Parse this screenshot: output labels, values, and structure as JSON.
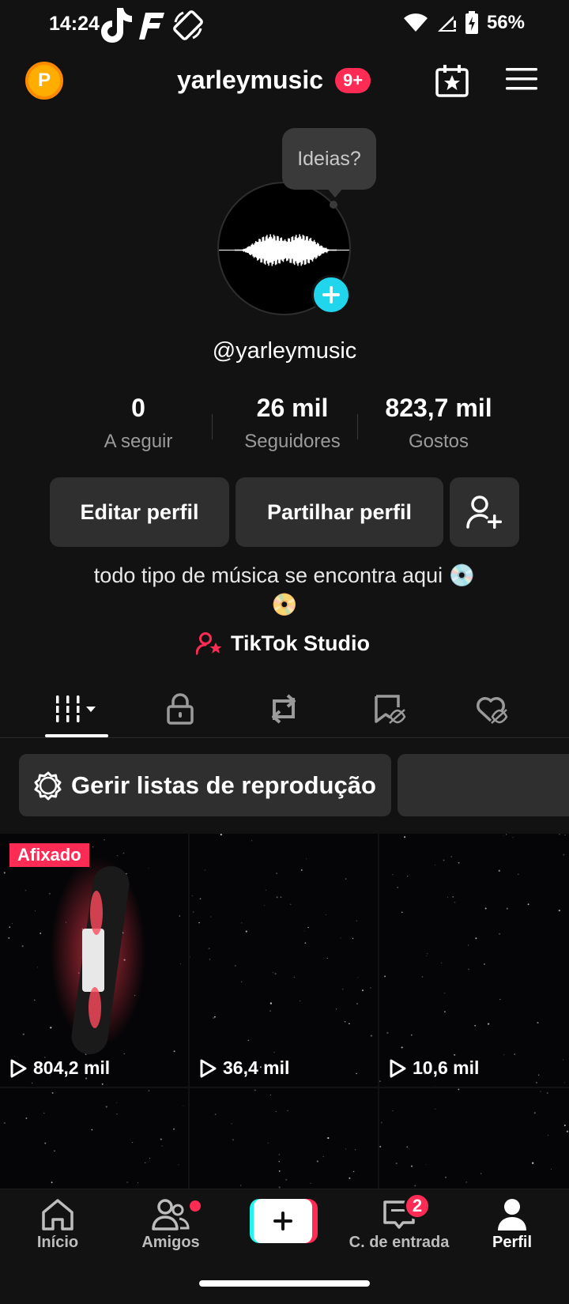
{
  "status": {
    "time": "14:24",
    "battery": "56%"
  },
  "header": {
    "username": "yarleymusic",
    "notifications": "9+",
    "coin_letter": "P"
  },
  "profile": {
    "tooltip": "Ideias?",
    "handle": "@yarleymusic",
    "stats": [
      {
        "value": "0",
        "label": "A seguir"
      },
      {
        "value": "26 mil",
        "label": "Seguidores"
      },
      {
        "value": "823,7 mil",
        "label": "Gostos"
      }
    ],
    "edit_label": "Editar perfil",
    "share_label": "Partilhar perfil",
    "bio_line1": "todo tipo de música se encontra aqui 💿",
    "bio_line2": "📀",
    "studio_label": "TikTok Studio"
  },
  "playlists": {
    "manage_label": "Gerir listas de reprodução"
  },
  "videos": [
    {
      "views": "804,2 mil",
      "pinned": "Afixado"
    },
    {
      "views": "36,4 mil"
    },
    {
      "views": "10,6 mil"
    }
  ],
  "nav": {
    "home": "Início",
    "friends": "Amigos",
    "inbox": "C. de entrada",
    "inbox_count": "2",
    "profile": "Perfil"
  },
  "colors": {
    "accent": "#fe2c55",
    "cyan": "#25f4ee",
    "avatar_add": "#20d5ec",
    "coin": "#ffae00"
  }
}
